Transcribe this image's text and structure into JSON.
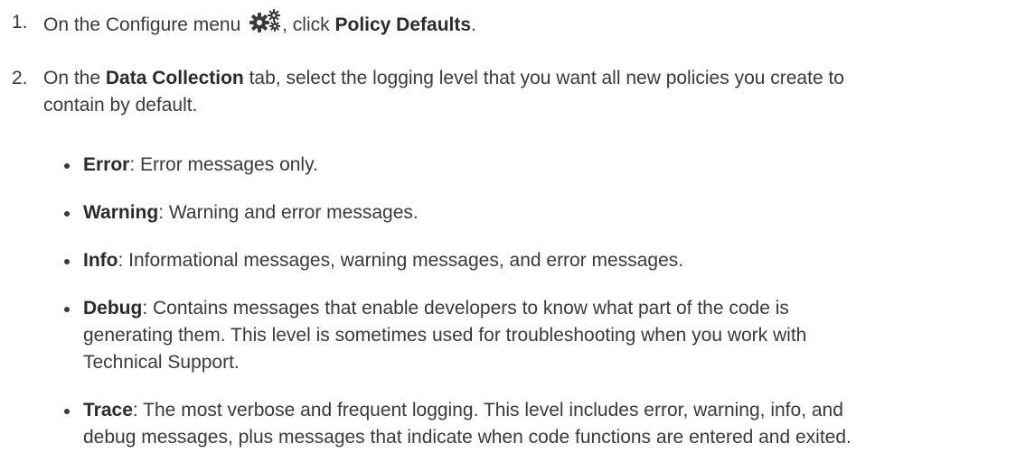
{
  "steps": [
    {
      "number": "1.",
      "parts": {
        "before_icon": "On the Configure menu",
        "after_icon": ", click ",
        "bold": "Policy Defaults",
        "end": "."
      },
      "icon": "gears-icon"
    },
    {
      "number": "2.",
      "parts": {
        "before": "On the ",
        "bold": "Data Collection",
        "line1_after": " tab, select the logging level that you want all new policies you create to",
        "line2": "contain by default."
      }
    }
  ],
  "levels": [
    {
      "name": "Error",
      "line1": ": Error messages only."
    },
    {
      "name": "Warning",
      "line1": ": Warning and error messages."
    },
    {
      "name": "Info",
      "line1": ": Informational messages, warning messages, and error messages."
    },
    {
      "name": "Debug",
      "line1": ": Contains messages that enable developers to know what part of the code is",
      "line2": "generating them. This level is sometimes used for troubleshooting when you work with",
      "line3": "Technical Support."
    },
    {
      "name": "Trace",
      "line1": ": The most verbose and frequent logging. This level includes error, warning, info, and",
      "line2": "debug messages, plus messages that indicate when code functions are entered and exited."
    }
  ],
  "colors": {
    "text": "#3a3a3a",
    "icon": "#3a3a3a"
  }
}
